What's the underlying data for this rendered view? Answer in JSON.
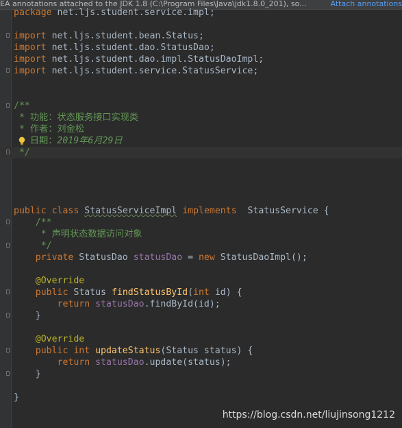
{
  "banner": {
    "message": "EA annotations attached to the JDK 1.8 (C:\\Program Files\\Java\\jdk1.8.0_201), so...",
    "action": "Attach annotations"
  },
  "code": {
    "package_kw": "package",
    "package_name": " net.ljs.student.service.impl;",
    "import_kw": "import",
    "imports": [
      " net.ljs.student.bean.Status;",
      " net.ljs.student.dao.StatusDao;",
      " net.ljs.student.dao.impl.StatusDaoImpl;",
      " net.ljs.student.service.StatusService;"
    ],
    "doc_open": "/**",
    "doc_line1": " * 功能：状态服务接口实现类",
    "doc_line2": " * 作者：刘金松",
    "doc_line3_prefix": " * 日期：",
    "doc_line3_date": "2019年6月29日",
    "doc_close": " */",
    "class_decl": {
      "public": "public",
      "class": "class",
      "name": "StatusServiceImpl",
      "implements": "implements",
      "iface": "  StatusService {"
    },
    "field_doc_open": "    /**",
    "field_doc_line": "     * 声明状态数据访问对象",
    "field_doc_close": "     */",
    "field": {
      "private": "    private",
      "type": " StatusDao ",
      "name": "statusDao",
      "eq": " = ",
      "new": "new",
      "init": " StatusDaoImpl();"
    },
    "override": "@Override",
    "method1": {
      "public": "    public",
      "ret": " Status ",
      "name": "findStatusById",
      "open": "(",
      "int": "int",
      "params": " id) {",
      "return": "        return",
      "field": " statusDao",
      "call": ".findById(id);",
      "close": "    }"
    },
    "method2": {
      "public": "    public",
      "int": " int",
      "name": " updateStatus",
      "params": "(Status status) {",
      "return": "        return",
      "field": " statusDao",
      "call": ".update(status);",
      "close": "    }"
    },
    "class_close": "}"
  },
  "watermark": "https://blog.csdn.net/liujinsong1212",
  "colors": {
    "background": "#2b2b2b",
    "keyword": "#cc7832",
    "comment": "#629755",
    "annotation": "#bbb529",
    "field": "#9876aa",
    "method": "#ffc66d",
    "text": "#a9b7c6",
    "link": "#589df6"
  },
  "icons": [
    "lightbulb-icon",
    "fold-marker-icon"
  ]
}
